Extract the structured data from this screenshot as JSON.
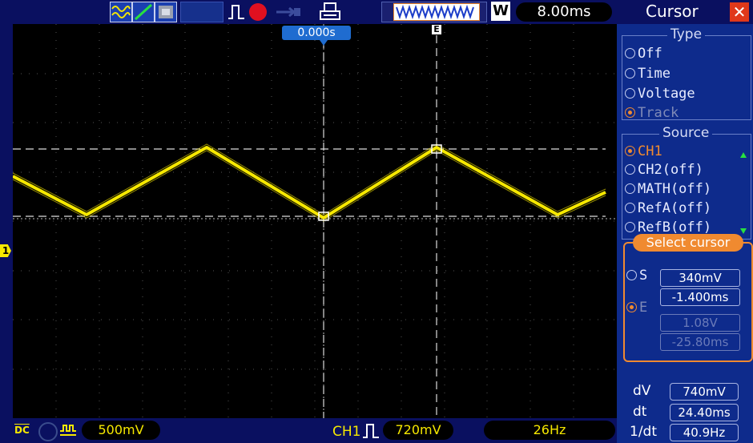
{
  "toolbar": {
    "timebase": "8.00ms",
    "trigger_mode": "W"
  },
  "scope": {
    "trigger_time": "0.000s",
    "cursor_tag": "E",
    "ch1_marker": "1"
  },
  "panel": {
    "title": "Cursor",
    "type_label": "Type",
    "type_options": [
      "Off",
      "Time",
      "Voltage",
      "Track"
    ],
    "source_label": "Source",
    "source_options": [
      "CH1",
      "CH2(off)",
      "MATH(off)",
      "RefA(off)",
      "RefB(off)"
    ],
    "select_cursor_label": "Select cursor",
    "s_label": "S",
    "e_label": "E",
    "s_voltage": "340mV",
    "s_time": "-1.400ms",
    "e_voltage": "1.08V",
    "e_time": "-25.80ms",
    "dv_label": "dV",
    "dv_value": "740mV",
    "dt_label": "dt",
    "dt_value": "24.40ms",
    "inv_dt_label": "1/dt",
    "inv_dt_value": "40.9Hz"
  },
  "bottom": {
    "coupling": "DC",
    "ch1_scale": "500mV",
    "trigger_source": "CH1",
    "trigger_level": "720mV",
    "frequency": "26Hz"
  },
  "colors": {
    "trace": "#f6e800",
    "accent": "#f08a30",
    "panel": "#0e2b8c"
  }
}
